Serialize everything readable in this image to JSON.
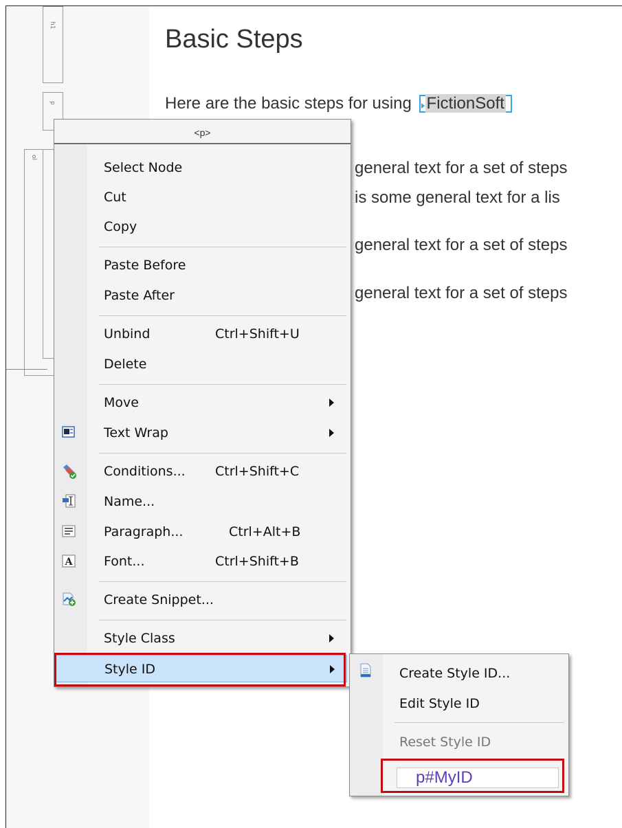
{
  "document": {
    "title": "Basic Steps",
    "intro_prefix": "Here are the basic steps for using ",
    "variable_text": "FictionSoft",
    "lines": [
      "general text for a set of steps",
      "is some general text for a lis",
      "general text for a set of steps",
      "general text for a set of steps"
    ]
  },
  "gutter": {
    "tags": [
      "h1",
      "p",
      "ol"
    ]
  },
  "context_menu": {
    "header": "<p>",
    "items": [
      {
        "label": "Select Node",
        "shortcut": "",
        "icon": "",
        "submenu": false
      },
      {
        "label": "Cut",
        "shortcut": "",
        "icon": "",
        "submenu": false
      },
      {
        "label": "Copy",
        "shortcut": "",
        "icon": "",
        "submenu": false
      },
      {
        "label": "Paste Before",
        "shortcut": "",
        "icon": "",
        "submenu": false
      },
      {
        "label": "Paste After",
        "shortcut": "",
        "icon": "",
        "submenu": false
      },
      {
        "label": "Unbind",
        "shortcut": "Ctrl+Shift+U",
        "icon": "",
        "submenu": false
      },
      {
        "label": "Delete",
        "shortcut": "",
        "icon": "",
        "submenu": false
      },
      {
        "label": "Move",
        "shortcut": "",
        "icon": "",
        "submenu": true
      },
      {
        "label": "Text Wrap",
        "shortcut": "",
        "icon": "text-wrap-icon",
        "submenu": true
      },
      {
        "label": "Conditions...",
        "shortcut": "Ctrl+Shift+C",
        "icon": "conditions-icon",
        "submenu": false
      },
      {
        "label": "Name...",
        "shortcut": "",
        "icon": "name-icon",
        "submenu": false
      },
      {
        "label": "Paragraph...",
        "shortcut": "Ctrl+Alt+B",
        "icon": "paragraph-icon",
        "submenu": false
      },
      {
        "label": "Font...",
        "shortcut": "Ctrl+Shift+B",
        "icon": "font-icon",
        "submenu": false
      },
      {
        "label": "Create Snippet...",
        "shortcut": "",
        "icon": "create-snippet-icon",
        "submenu": false
      },
      {
        "label": "Style Class",
        "shortcut": "",
        "icon": "",
        "submenu": true
      },
      {
        "label": "Style ID",
        "shortcut": "",
        "icon": "",
        "submenu": true,
        "highlighted": true
      }
    ]
  },
  "style_id_submenu": {
    "items": [
      {
        "label": "Create Style ID...",
        "icon": "create-style-id-icon",
        "enabled": true
      },
      {
        "label": "Edit Style ID",
        "icon": "",
        "enabled": true
      },
      {
        "label": "Reset Style ID",
        "icon": "",
        "enabled": false
      }
    ],
    "current_id": "p#MyID"
  },
  "colors": {
    "highlight": "#c9e3fb",
    "callout_outline": "#c00d12",
    "variable_marker": "#3aa3e3",
    "style_id_text": "#5d3fb5"
  }
}
